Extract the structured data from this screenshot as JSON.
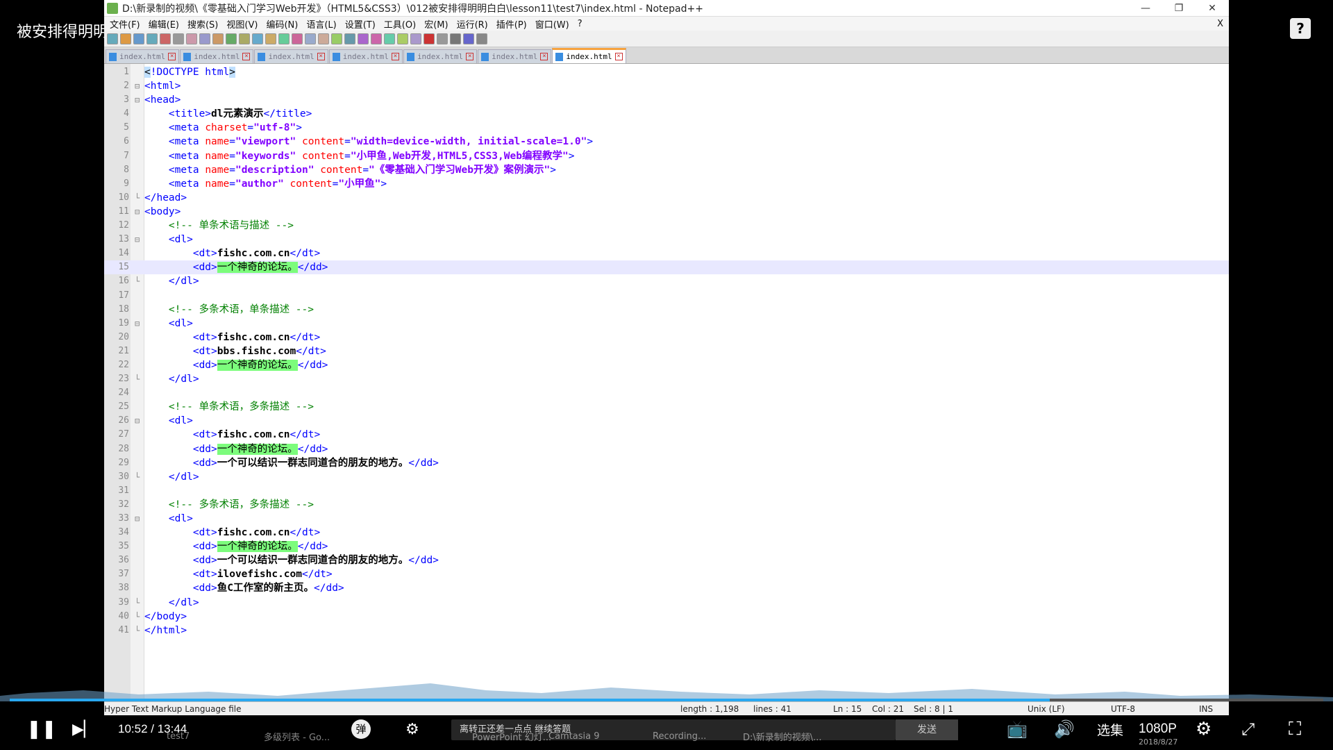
{
  "video": {
    "title": "被安排得明明白白"
  },
  "window": {
    "title": "D:\\新录制的视频\\《零基础入门学习Web开发》（HTML5&CSS3）\\012被安排得明明白白\\lesson11\\test7\\index.html - Notepad++"
  },
  "menu": [
    "文件(F)",
    "编辑(E)",
    "搜索(S)",
    "视图(V)",
    "编码(N)",
    "语言(L)",
    "设置(T)",
    "工具(O)",
    "宏(M)",
    "运行(R)",
    "插件(P)",
    "窗口(W)",
    "?"
  ],
  "menu_close": "X",
  "tabs": [
    "index.html",
    "index.html",
    "index.html",
    "index.html",
    "index.html",
    "index.html",
    "index.html"
  ],
  "editor": {
    "current_line": 15,
    "lines": [
      {
        "n": "1",
        "fold": "",
        "parts": [
          [
            "brace",
            "<"
          ],
          [
            "tag",
            "!DOCTYPE html"
          ],
          [
            "brace",
            ">"
          ]
        ]
      },
      {
        "n": "2",
        "fold": "⊟",
        "parts": [
          [
            "tag",
            "<html>"
          ]
        ]
      },
      {
        "n": "3",
        "fold": "⊟",
        "parts": [
          [
            "tag",
            "<head>"
          ]
        ]
      },
      {
        "n": "4",
        "fold": "",
        "parts": [
          [
            "",
            "    "
          ],
          [
            "tag",
            "<title>"
          ],
          [
            "txt",
            "dl元素演示"
          ],
          [
            "tag",
            "</title>"
          ]
        ]
      },
      {
        "n": "5",
        "fold": "",
        "parts": [
          [
            "",
            "    "
          ],
          [
            "tag",
            "<meta "
          ],
          [
            "attr",
            "charset"
          ],
          [
            "tag",
            "="
          ],
          [
            "str",
            "\"utf-8\""
          ],
          [
            "tag",
            ">"
          ]
        ]
      },
      {
        "n": "6",
        "fold": "",
        "parts": [
          [
            "",
            "    "
          ],
          [
            "tag",
            "<meta "
          ],
          [
            "attr",
            "name"
          ],
          [
            "tag",
            "="
          ],
          [
            "str",
            "\"viewport\""
          ],
          [
            "",
            " "
          ],
          [
            "attr",
            "content"
          ],
          [
            "tag",
            "="
          ],
          [
            "str",
            "\"width=device-width, initial-scale=1.0\""
          ],
          [
            "tag",
            ">"
          ]
        ]
      },
      {
        "n": "7",
        "fold": "",
        "parts": [
          [
            "",
            "    "
          ],
          [
            "tag",
            "<meta "
          ],
          [
            "attr",
            "name"
          ],
          [
            "tag",
            "="
          ],
          [
            "str",
            "\"keywords\""
          ],
          [
            "",
            " "
          ],
          [
            "attr",
            "content"
          ],
          [
            "tag",
            "="
          ],
          [
            "str",
            "\"小甲鱼,Web开发,HTML5,CSS3,Web编程教学\""
          ],
          [
            "tag",
            ">"
          ]
        ]
      },
      {
        "n": "8",
        "fold": "",
        "parts": [
          [
            "",
            "    "
          ],
          [
            "tag",
            "<meta "
          ],
          [
            "attr",
            "name"
          ],
          [
            "tag",
            "="
          ],
          [
            "str",
            "\"description\""
          ],
          [
            "",
            " "
          ],
          [
            "attr",
            "content"
          ],
          [
            "tag",
            "="
          ],
          [
            "str",
            "\"《零基础入门学习Web开发》案例演示\""
          ],
          [
            "tag",
            ">"
          ]
        ]
      },
      {
        "n": "9",
        "fold": "",
        "parts": [
          [
            "",
            "    "
          ],
          [
            "tag",
            "<meta "
          ],
          [
            "attr",
            "name"
          ],
          [
            "tag",
            "="
          ],
          [
            "str",
            "\"author\""
          ],
          [
            "",
            " "
          ],
          [
            "attr",
            "content"
          ],
          [
            "tag",
            "="
          ],
          [
            "str",
            "\"小甲鱼\""
          ],
          [
            "tag",
            ">"
          ]
        ]
      },
      {
        "n": "10",
        "fold": "└",
        "parts": [
          [
            "tag",
            "</head>"
          ]
        ]
      },
      {
        "n": "11",
        "fold": "⊟",
        "parts": [
          [
            "tag",
            "<body>"
          ]
        ]
      },
      {
        "n": "12",
        "fold": "",
        "parts": [
          [
            "",
            "    "
          ],
          [
            "cmt",
            "<!-- 单条术语与描述 -->"
          ]
        ]
      },
      {
        "n": "13",
        "fold": "⊟",
        "parts": [
          [
            "",
            "    "
          ],
          [
            "tag",
            "<dl>"
          ]
        ]
      },
      {
        "n": "14",
        "fold": "",
        "parts": [
          [
            "",
            "        "
          ],
          [
            "tag",
            "<dt>"
          ],
          [
            "txt",
            "fishc.com.cn"
          ],
          [
            "tag",
            "</dt>"
          ]
        ]
      },
      {
        "n": "15",
        "fold": "",
        "parts": [
          [
            "",
            "        "
          ],
          [
            "tag",
            "<dd>"
          ],
          [
            "hl",
            "一个神奇的论坛。"
          ],
          [
            "tag",
            "</dd>"
          ]
        ]
      },
      {
        "n": "16",
        "fold": "└",
        "parts": [
          [
            "",
            "    "
          ],
          [
            "tag",
            "</dl>"
          ]
        ]
      },
      {
        "n": "17",
        "fold": "",
        "parts": []
      },
      {
        "n": "18",
        "fold": "",
        "parts": [
          [
            "",
            "    "
          ],
          [
            "cmt",
            "<!-- 多条术语，单条描述 -->"
          ]
        ]
      },
      {
        "n": "19",
        "fold": "⊟",
        "parts": [
          [
            "",
            "    "
          ],
          [
            "tag",
            "<dl>"
          ]
        ]
      },
      {
        "n": "20",
        "fold": "",
        "parts": [
          [
            "",
            "        "
          ],
          [
            "tag",
            "<dt>"
          ],
          [
            "txt",
            "fishc.com.cn"
          ],
          [
            "tag",
            "</dt>"
          ]
        ]
      },
      {
        "n": "21",
        "fold": "",
        "parts": [
          [
            "",
            "        "
          ],
          [
            "tag",
            "<dt>"
          ],
          [
            "txt",
            "bbs.fishc.com"
          ],
          [
            "tag",
            "</dt>"
          ]
        ]
      },
      {
        "n": "22",
        "fold": "",
        "parts": [
          [
            "",
            "        "
          ],
          [
            "tag",
            "<dd>"
          ],
          [
            "hl",
            "一个神奇的论坛。"
          ],
          [
            "tag",
            "</dd>"
          ]
        ]
      },
      {
        "n": "23",
        "fold": "└",
        "parts": [
          [
            "",
            "    "
          ],
          [
            "tag",
            "</dl>"
          ]
        ]
      },
      {
        "n": "24",
        "fold": "",
        "parts": []
      },
      {
        "n": "25",
        "fold": "",
        "parts": [
          [
            "",
            "    "
          ],
          [
            "cmt",
            "<!-- 单条术语，多条描述 -->"
          ]
        ]
      },
      {
        "n": "26",
        "fold": "⊟",
        "parts": [
          [
            "",
            "    "
          ],
          [
            "tag",
            "<dl>"
          ]
        ]
      },
      {
        "n": "27",
        "fold": "",
        "parts": [
          [
            "",
            "        "
          ],
          [
            "tag",
            "<dt>"
          ],
          [
            "txt",
            "fishc.com.cn"
          ],
          [
            "tag",
            "</dt>"
          ]
        ]
      },
      {
        "n": "28",
        "fold": "",
        "parts": [
          [
            "",
            "        "
          ],
          [
            "tag",
            "<dd>"
          ],
          [
            "hl",
            "一个神奇的论坛。"
          ],
          [
            "tag",
            "</dd>"
          ]
        ]
      },
      {
        "n": "29",
        "fold": "",
        "parts": [
          [
            "",
            "        "
          ],
          [
            "tag",
            "<dd>"
          ],
          [
            "txt",
            "一个可以结识一群志同道合的朋友的地方。"
          ],
          [
            "tag",
            "</dd>"
          ]
        ]
      },
      {
        "n": "30",
        "fold": "└",
        "parts": [
          [
            "",
            "    "
          ],
          [
            "tag",
            "</dl>"
          ]
        ]
      },
      {
        "n": "31",
        "fold": "",
        "parts": []
      },
      {
        "n": "32",
        "fold": "",
        "parts": [
          [
            "",
            "    "
          ],
          [
            "cmt",
            "<!-- 多条术语，多条描述 -->"
          ]
        ]
      },
      {
        "n": "33",
        "fold": "⊟",
        "parts": [
          [
            "",
            "    "
          ],
          [
            "tag",
            "<dl>"
          ]
        ]
      },
      {
        "n": "34",
        "fold": "",
        "parts": [
          [
            "",
            "        "
          ],
          [
            "tag",
            "<dt>"
          ],
          [
            "txt",
            "fishc.com.cn"
          ],
          [
            "tag",
            "</dt>"
          ]
        ]
      },
      {
        "n": "35",
        "fold": "",
        "parts": [
          [
            "",
            "        "
          ],
          [
            "tag",
            "<dd>"
          ],
          [
            "hl",
            "一个神奇的论坛。"
          ],
          [
            "tag",
            "</dd>"
          ]
        ]
      },
      {
        "n": "36",
        "fold": "",
        "parts": [
          [
            "",
            "        "
          ],
          [
            "tag",
            "<dd>"
          ],
          [
            "txt",
            "一个可以结识一群志同道合的朋友的地方。"
          ],
          [
            "tag",
            "</dd>"
          ]
        ]
      },
      {
        "n": "37",
        "fold": "",
        "parts": [
          [
            "",
            "        "
          ],
          [
            "tag",
            "<dt>"
          ],
          [
            "txt",
            "ilovefishc.com"
          ],
          [
            "tag",
            "</dt>"
          ]
        ]
      },
      {
        "n": "38",
        "fold": "",
        "parts": [
          [
            "",
            "        "
          ],
          [
            "tag",
            "<dd>"
          ],
          [
            "txt",
            "鱼C工作室的新主页。"
          ],
          [
            "tag",
            "</dd>"
          ]
        ]
      },
      {
        "n": "39",
        "fold": "└",
        "parts": [
          [
            "",
            "    "
          ],
          [
            "tag",
            "</dl>"
          ]
        ]
      },
      {
        "n": "40",
        "fold": "└",
        "parts": [
          [
            "tag",
            "</body>"
          ]
        ]
      },
      {
        "n": "41",
        "fold": "└",
        "parts": [
          [
            "tag",
            "</html>"
          ]
        ]
      }
    ]
  },
  "status": {
    "lang": "Hyper Text Markup Language file",
    "length": "length : 1,198",
    "lines": "lines : 41",
    "ln": "Ln : 15",
    "col": "Col : 21",
    "sel": "Sel : 8 | 1",
    "eol": "Unix (LF)",
    "encoding": "UTF-8",
    "mode": "INS"
  },
  "player": {
    "time": "10:52 / 13:44",
    "progress": 0.792,
    "danmaku_chip": "弹",
    "danmaku_placeholder": "离转正还差一点点 继续答题",
    "send": "发送",
    "select": "选集",
    "quality": "1080P",
    "date": "2018/8/27"
  },
  "taskbar": [
    "test7",
    "多级列表 - Go...",
    "PowerPoint 幻灯...",
    "Camtasia 9",
    "Recording...",
    "D:\\新录制的视频\\..."
  ]
}
